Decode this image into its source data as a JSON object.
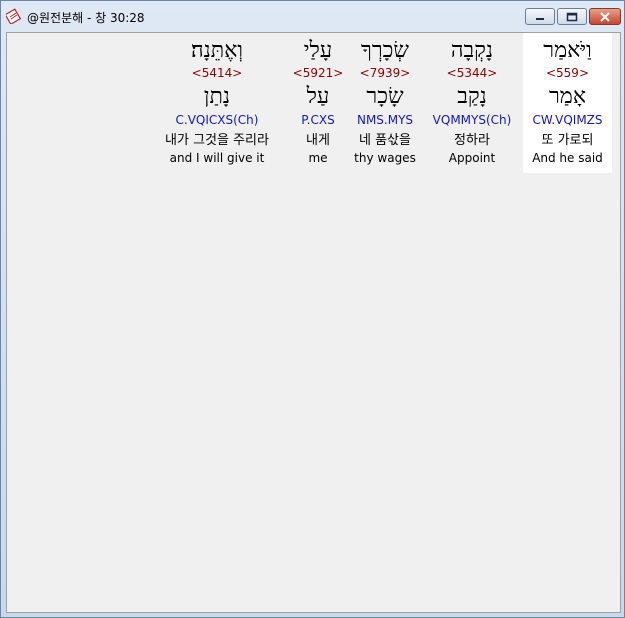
{
  "window": {
    "title": "@원전분해 - 창 30:28"
  },
  "words": [
    {
      "hebrew": "וַיֹּאמַר",
      "strong": "<559>",
      "lemma": "אָמַר",
      "parse": "CW.VQIMZS",
      "korean": "또 가로되",
      "english": "And he said",
      "selected": true
    },
    {
      "hebrew": "נָקְבָה",
      "strong": "<5344>",
      "lemma": "נָקַב",
      "parse": "VQMMYS(Ch)",
      "korean": "정하라",
      "english": "Appoint",
      "selected": false
    },
    {
      "hebrew": "שְׂכָרְךָ",
      "strong": "<7939>",
      "lemma": "שָׂכָר",
      "parse": "NMS.MYS",
      "korean": "네 품삯을",
      "english": "thy wages",
      "selected": false
    },
    {
      "hebrew": "עָלַי",
      "strong": "<5921>",
      "lemma": "עַל",
      "parse": "P.CXS",
      "korean": "내게",
      "english": "me",
      "selected": false
    },
    {
      "hebrew": "וְאֶתֵּנָה׃",
      "strong": "<5414>",
      "lemma": "נָתַן",
      "parse": "C.VQICXS(Ch)",
      "korean": "내가 그것을 주리라",
      "english": "and I will give it",
      "selected": false
    }
  ]
}
